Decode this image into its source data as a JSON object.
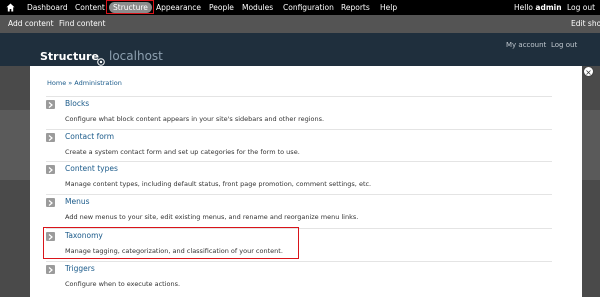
{
  "toolbar": {
    "items": [
      "Dashboard",
      "Content",
      "Structure",
      "Appearance",
      "People",
      "Modules",
      "Configuration",
      "Reports",
      "Help"
    ],
    "hello_prefix": "Hello",
    "username": "admin",
    "logout": "Log out"
  },
  "shortcuts": {
    "add_content": "Add content",
    "find_content": "Find content",
    "edit_shortcuts": "Edit shor"
  },
  "page": {
    "title": "Structure",
    "site_name": "localhost",
    "my_account": "My account",
    "log_out": "Log out"
  },
  "modal": {
    "breadcrumb": "Home » Administration",
    "items": [
      {
        "title": "Blocks",
        "desc": "Configure what block content appears in your site's sidebars and other regions."
      },
      {
        "title": "Contact form",
        "desc": "Create a system contact form and set up categories for the form to use."
      },
      {
        "title": "Content types",
        "desc": "Manage content types, including default status, front page promotion, comment settings, etc."
      },
      {
        "title": "Menus",
        "desc": "Add new menus to your site, edit existing menus, and rename and reorganize menu links."
      },
      {
        "title": "Taxonomy",
        "desc": "Manage tagging, categorization, and classification of your content."
      },
      {
        "title": "Triggers",
        "desc": "Configure when to execute actions."
      }
    ]
  },
  "colors": {
    "toolbar_bg": "#000000",
    "highlight": "#d9141a",
    "link": "#1a5a8a"
  }
}
